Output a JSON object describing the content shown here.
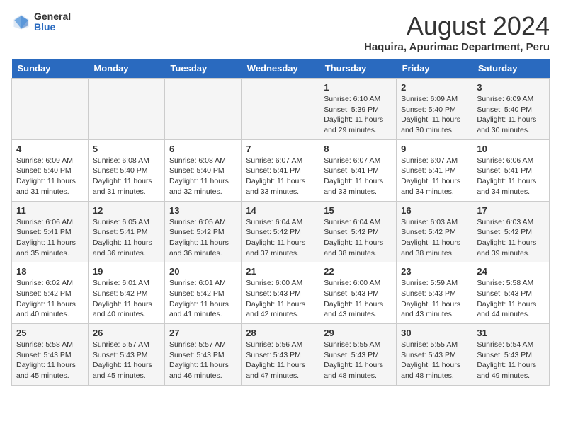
{
  "logo": {
    "general": "General",
    "blue": "Blue"
  },
  "title": "August 2024",
  "subtitle": "Haquira, Apurimac Department, Peru",
  "days_of_week": [
    "Sunday",
    "Monday",
    "Tuesday",
    "Wednesday",
    "Thursday",
    "Friday",
    "Saturday"
  ],
  "weeks": [
    [
      {
        "day": "",
        "detail": ""
      },
      {
        "day": "",
        "detail": ""
      },
      {
        "day": "",
        "detail": ""
      },
      {
        "day": "",
        "detail": ""
      },
      {
        "day": "1",
        "detail": "Sunrise: 6:10 AM\nSunset: 5:39 PM\nDaylight: 11 hours and 29 minutes."
      },
      {
        "day": "2",
        "detail": "Sunrise: 6:09 AM\nSunset: 5:40 PM\nDaylight: 11 hours and 30 minutes."
      },
      {
        "day": "3",
        "detail": "Sunrise: 6:09 AM\nSunset: 5:40 PM\nDaylight: 11 hours and 30 minutes."
      }
    ],
    [
      {
        "day": "4",
        "detail": "Sunrise: 6:09 AM\nSunset: 5:40 PM\nDaylight: 11 hours and 31 minutes."
      },
      {
        "day": "5",
        "detail": "Sunrise: 6:08 AM\nSunset: 5:40 PM\nDaylight: 11 hours and 31 minutes."
      },
      {
        "day": "6",
        "detail": "Sunrise: 6:08 AM\nSunset: 5:40 PM\nDaylight: 11 hours and 32 minutes."
      },
      {
        "day": "7",
        "detail": "Sunrise: 6:07 AM\nSunset: 5:41 PM\nDaylight: 11 hours and 33 minutes."
      },
      {
        "day": "8",
        "detail": "Sunrise: 6:07 AM\nSunset: 5:41 PM\nDaylight: 11 hours and 33 minutes."
      },
      {
        "day": "9",
        "detail": "Sunrise: 6:07 AM\nSunset: 5:41 PM\nDaylight: 11 hours and 34 minutes."
      },
      {
        "day": "10",
        "detail": "Sunrise: 6:06 AM\nSunset: 5:41 PM\nDaylight: 11 hours and 34 minutes."
      }
    ],
    [
      {
        "day": "11",
        "detail": "Sunrise: 6:06 AM\nSunset: 5:41 PM\nDaylight: 11 hours and 35 minutes."
      },
      {
        "day": "12",
        "detail": "Sunrise: 6:05 AM\nSunset: 5:41 PM\nDaylight: 11 hours and 36 minutes."
      },
      {
        "day": "13",
        "detail": "Sunrise: 6:05 AM\nSunset: 5:42 PM\nDaylight: 11 hours and 36 minutes."
      },
      {
        "day": "14",
        "detail": "Sunrise: 6:04 AM\nSunset: 5:42 PM\nDaylight: 11 hours and 37 minutes."
      },
      {
        "day": "15",
        "detail": "Sunrise: 6:04 AM\nSunset: 5:42 PM\nDaylight: 11 hours and 38 minutes."
      },
      {
        "day": "16",
        "detail": "Sunrise: 6:03 AM\nSunset: 5:42 PM\nDaylight: 11 hours and 38 minutes."
      },
      {
        "day": "17",
        "detail": "Sunrise: 6:03 AM\nSunset: 5:42 PM\nDaylight: 11 hours and 39 minutes."
      }
    ],
    [
      {
        "day": "18",
        "detail": "Sunrise: 6:02 AM\nSunset: 5:42 PM\nDaylight: 11 hours and 40 minutes."
      },
      {
        "day": "19",
        "detail": "Sunrise: 6:01 AM\nSunset: 5:42 PM\nDaylight: 11 hours and 40 minutes."
      },
      {
        "day": "20",
        "detail": "Sunrise: 6:01 AM\nSunset: 5:42 PM\nDaylight: 11 hours and 41 minutes."
      },
      {
        "day": "21",
        "detail": "Sunrise: 6:00 AM\nSunset: 5:43 PM\nDaylight: 11 hours and 42 minutes."
      },
      {
        "day": "22",
        "detail": "Sunrise: 6:00 AM\nSunset: 5:43 PM\nDaylight: 11 hours and 43 minutes."
      },
      {
        "day": "23",
        "detail": "Sunrise: 5:59 AM\nSunset: 5:43 PM\nDaylight: 11 hours and 43 minutes."
      },
      {
        "day": "24",
        "detail": "Sunrise: 5:58 AM\nSunset: 5:43 PM\nDaylight: 11 hours and 44 minutes."
      }
    ],
    [
      {
        "day": "25",
        "detail": "Sunrise: 5:58 AM\nSunset: 5:43 PM\nDaylight: 11 hours and 45 minutes."
      },
      {
        "day": "26",
        "detail": "Sunrise: 5:57 AM\nSunset: 5:43 PM\nDaylight: 11 hours and 45 minutes."
      },
      {
        "day": "27",
        "detail": "Sunrise: 5:57 AM\nSunset: 5:43 PM\nDaylight: 11 hours and 46 minutes."
      },
      {
        "day": "28",
        "detail": "Sunrise: 5:56 AM\nSunset: 5:43 PM\nDaylight: 11 hours and 47 minutes."
      },
      {
        "day": "29",
        "detail": "Sunrise: 5:55 AM\nSunset: 5:43 PM\nDaylight: 11 hours and 48 minutes."
      },
      {
        "day": "30",
        "detail": "Sunrise: 5:55 AM\nSunset: 5:43 PM\nDaylight: 11 hours and 48 minutes."
      },
      {
        "day": "31",
        "detail": "Sunrise: 5:54 AM\nSunset: 5:43 PM\nDaylight: 11 hours and 49 minutes."
      }
    ]
  ]
}
